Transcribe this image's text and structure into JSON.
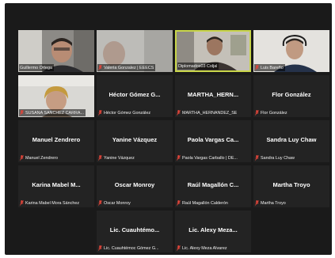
{
  "participants": [
    {
      "name": "Guillermo Ortega",
      "video": true,
      "active": false
    },
    {
      "name": "Valeria Gonzalez | EEECS",
      "video": true,
      "active": false
    },
    {
      "name": "Diplomados03 Coljal",
      "video": true,
      "active": true
    },
    {
      "name": "Luis Bareño",
      "video": true,
      "active": false
    },
    {
      "name": "SUSANA SANCHEZ CARRA...",
      "video": true,
      "active": false
    },
    {
      "display": "Héctor Gómez G...",
      "name": "Héctor Gómez González",
      "video": false
    },
    {
      "display": "MARTHA_HERN...",
      "name": "MARTHA_HERNANDEZ_SE",
      "video": false
    },
    {
      "display": "Flor González",
      "name": "Flor González",
      "video": false
    },
    {
      "display": "Manuel Zendrero",
      "name": "Manuel Zendrero",
      "video": false
    },
    {
      "display": "Yanine Vázquez",
      "name": "Yanine Vázquez",
      "video": false
    },
    {
      "display": "Paola Vargas Ca...",
      "name": "Paola Vargas Carballo | DE...",
      "video": false
    },
    {
      "display": "Sandra Luy Chaw",
      "name": "Sandra Luy Chaw",
      "video": false
    },
    {
      "display": "Karina Mabel M...",
      "name": "Karina Mabel Mora Sánchez",
      "video": false
    },
    {
      "display": "Oscar Monroy",
      "name": "Oscar Monroy",
      "video": false
    },
    {
      "display": "Raúl Magallón C...",
      "name": "Raúl Magallón Calderón",
      "video": false
    },
    {
      "display": "Martha Troyo",
      "name": "Martha Troyo",
      "video": false
    },
    {
      "display": "Lic. Cuauhtémo...",
      "name": "Lic. Cuauhtémoc Gómez G...",
      "video": false
    },
    {
      "display": "Lic. Alexy Meza...",
      "name": "Lic. Alexy Meza Alvarez",
      "video": false
    }
  ],
  "colors": {
    "muted_mic": "#e0453a",
    "active_speaker": "#c9d64a",
    "tile": "#232323",
    "background": "#1a1a1a"
  }
}
